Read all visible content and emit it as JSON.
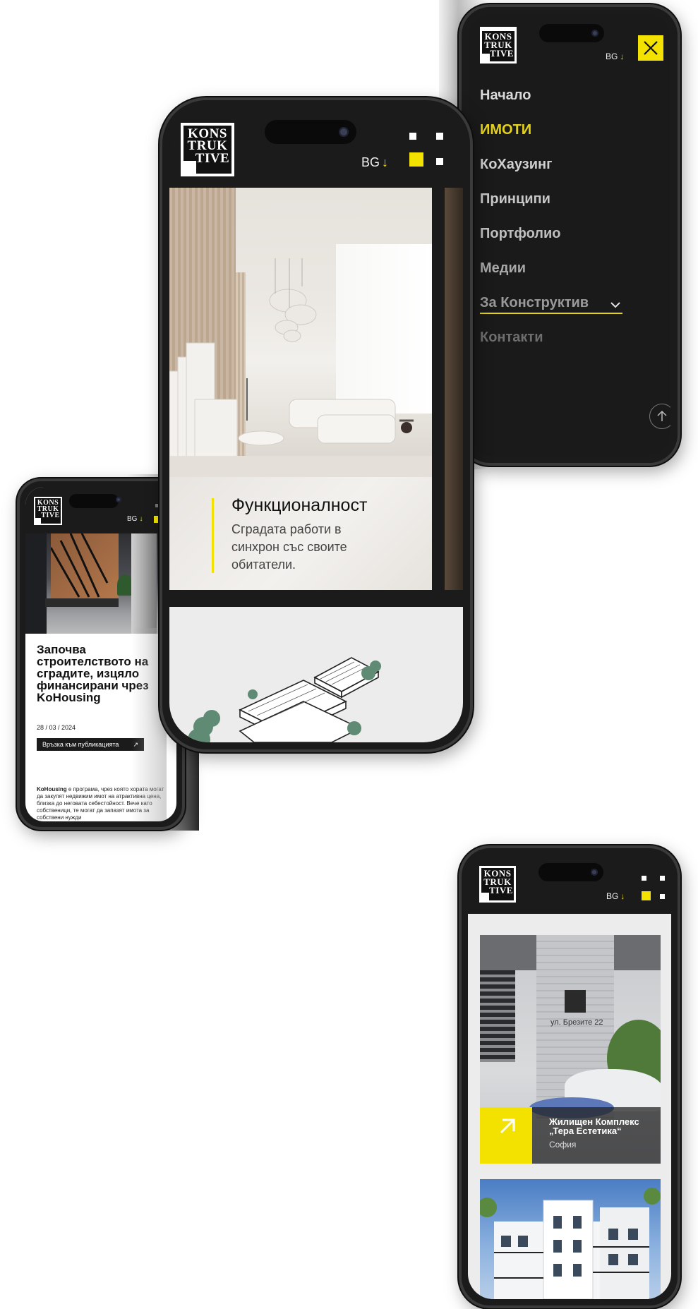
{
  "brand": {
    "logo_lines": [
      "KONS",
      "TRUK",
      "TIVE"
    ]
  },
  "colors": {
    "accent": "#f3e200",
    "dark": "#1b1b1b",
    "light": "#ececec"
  },
  "phone_menu": {
    "lang": "BG",
    "close_icon": "close-icon",
    "items": [
      {
        "label": "Начало"
      },
      {
        "label": "ИМОТИ",
        "active": true
      },
      {
        "label": "КоХаузинг"
      },
      {
        "label": "Принципи"
      },
      {
        "label": "Портфолио"
      },
      {
        "label": "Медии"
      },
      {
        "label": "За Конструктив",
        "has_dropdown": true
      },
      {
        "label": "Контакти"
      }
    ],
    "scroll_top_icon": "arrow-up-icon"
  },
  "phone_main": {
    "lang": "BG",
    "slide": {
      "title": "Функционалност",
      "text": "Сградата работи в синхрон със своите обитатели."
    }
  },
  "phone_article": {
    "lang": "BG",
    "title": "Започва строителството на сградите, изцяло финансирани чрез KoHousing",
    "date": "28 / 03 / 2024",
    "link_label": "Връзка към публикацията",
    "body_bold": "KoHousing",
    "body": " е програма, чрез която хората могат да закупят недвижим имот на атрактивна цена, близка до неговата себестойност. Вече като собственици, те могат да запазят имота за собствени нужди"
  },
  "phone_listing": {
    "lang": "BG",
    "card1": {
      "sign": "ул. Брезите 22",
      "title": "Жилищен Комплекс „Тера Естетика“",
      "city": "София"
    }
  }
}
